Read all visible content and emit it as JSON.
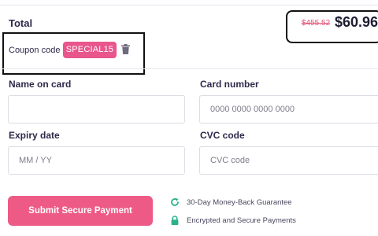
{
  "summary": {
    "total_label": "Total",
    "old_price": "$455.52",
    "new_price": "$60.96"
  },
  "coupon": {
    "label": "Coupon code",
    "code": "SPECIAL15",
    "remove_icon": "trash-icon"
  },
  "form": {
    "name_on_card": {
      "label": "Name on card",
      "value": "",
      "placeholder": ""
    },
    "card_number": {
      "label": "Card number",
      "value": "",
      "placeholder": "0000 0000 0000 0000"
    },
    "expiry_date": {
      "label": "Expiry date",
      "value": "",
      "placeholder": "MM / YY"
    },
    "cvc_code": {
      "label": "CVC code",
      "value": "",
      "placeholder": "CVC code"
    }
  },
  "submit": {
    "label": "Submit Secure Payment"
  },
  "assurances": [
    {
      "icon": "refresh-icon",
      "text": "30-Day Money-Back Guarantee"
    },
    {
      "icon": "lock-icon",
      "text": "Encrypted and Secure Payments"
    }
  ],
  "colors": {
    "accent": "#ee5a86",
    "badge": "#e8568b",
    "old_price": "#e25577",
    "assurance_icon": "#2bb28a",
    "text": "#2d2a4a"
  }
}
